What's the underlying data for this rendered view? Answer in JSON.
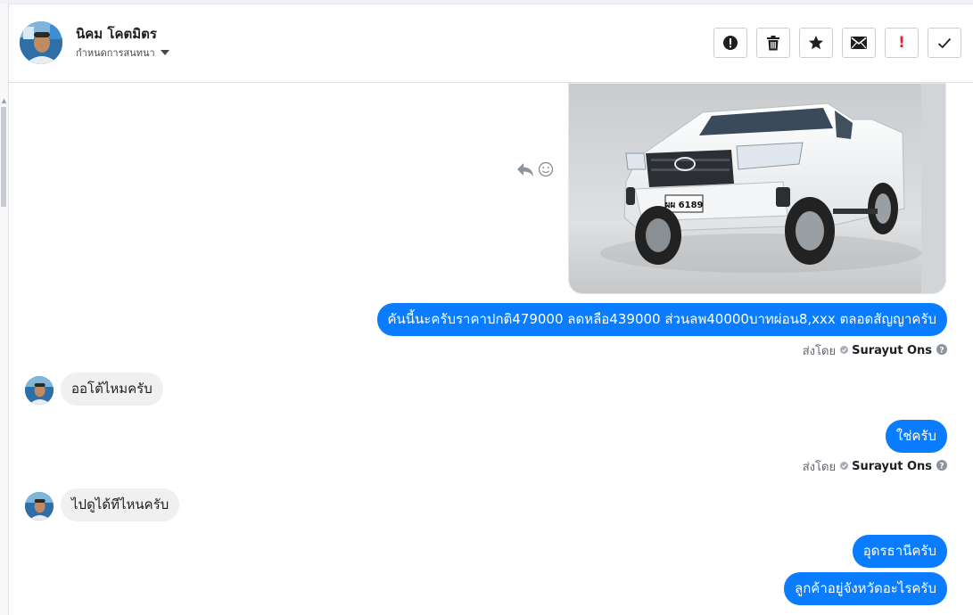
{
  "conversation": {
    "contact_name": "นิคม โคตมิตร",
    "assign_label": "กำหนดการสนทนา"
  },
  "toolbar": {
    "buttons": [
      {
        "icon": "alert-circle-icon",
        "label": ""
      },
      {
        "icon": "trash-icon",
        "label": ""
      },
      {
        "icon": "star-icon",
        "label": ""
      },
      {
        "icon": "envelope-icon",
        "label": ""
      },
      {
        "icon": "exclamation-icon",
        "label": "!"
      },
      {
        "icon": "check-icon",
        "label": ""
      }
    ]
  },
  "messages": {
    "m1": {
      "direction": "outgoing",
      "type": "image",
      "image": "white-pickup-truck-photo",
      "plate": "ผผ 6189"
    },
    "m2": {
      "direction": "outgoing",
      "text": "คันนี้นะครับราคาปกติ479000 ลดหลือ439000 ส่วนลพ40000บาทผ่อน8,xxx ตลอดสัญญาครับ"
    },
    "m2_meta": {
      "sent_by_label": "ส่งโดย",
      "agent": "Surayut Ons"
    },
    "m3": {
      "direction": "incoming",
      "text": "ออโต้ไหมครับ"
    },
    "m4": {
      "direction": "outgoing",
      "text": "ใช่ครับ"
    },
    "m4_meta": {
      "sent_by_label": "ส่งโดย",
      "agent": "Surayut Ons"
    },
    "m5": {
      "direction": "incoming",
      "text": "ไปดูได้ทีไหนครับ"
    },
    "m6": {
      "direction": "outgoing",
      "text": "อุดรธานีครับ"
    },
    "m7": {
      "direction": "outgoing",
      "text": "ลูกค้าอยู่จังหวัดอะไรครับ"
    }
  },
  "colors": {
    "outgoing_bubble": "#0a7cff",
    "incoming_bubble": "#f0f0f0",
    "exclamation": "#e0283a"
  }
}
